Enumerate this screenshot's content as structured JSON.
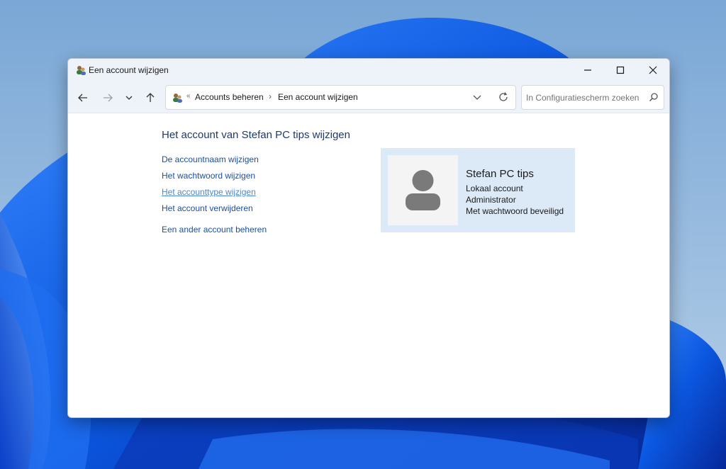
{
  "window": {
    "title": "Een account wijzigen",
    "minimize_icon": "minimize-icon",
    "maximize_icon": "maximize-icon",
    "close_icon": "close-icon"
  },
  "nav": {
    "back_icon": "arrow-left-icon",
    "forward_icon": "arrow-right-icon",
    "recent_icon": "chevron-down-icon",
    "up_icon": "arrow-up-icon",
    "breadcrumbs": [
      "Accounts beheren",
      "Een account wijzigen"
    ],
    "search_placeholder": "In Configuratiescherm zoeken"
  },
  "main": {
    "heading": "Het account van Stefan PC tips wijzigen",
    "links": [
      "De accountnaam wijzigen",
      "Het wachtwoord wijzigen",
      "Het accounttype wijzigen",
      "Het account verwijderen"
    ],
    "other_link": "Een ander account beheren"
  },
  "user_card": {
    "name": "Stefan PC tips",
    "account_type": "Lokaal account",
    "role": "Administrator",
    "password_status": "Met wachtwoord beveiligd"
  },
  "colors": {
    "link": "#1c4f9c",
    "link_hover": "#4a86d8",
    "heading": "#1e3a6e",
    "card_bg": "#dceaf8"
  }
}
